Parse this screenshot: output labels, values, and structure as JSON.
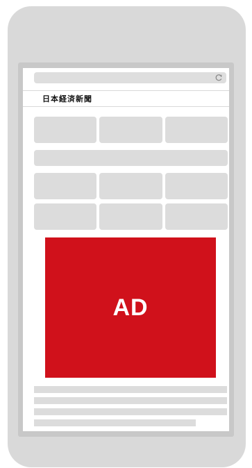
{
  "browser": {
    "url_value": "",
    "reload_icon": "reload-icon"
  },
  "site": {
    "logo": "日本経済新聞"
  },
  "ad": {
    "label": "AD",
    "color": "#d0111b"
  },
  "colors": {
    "phone_frame": "#d9d9d9",
    "screen_border": "#c8c8c8",
    "placeholder": "#dcdcdc"
  }
}
